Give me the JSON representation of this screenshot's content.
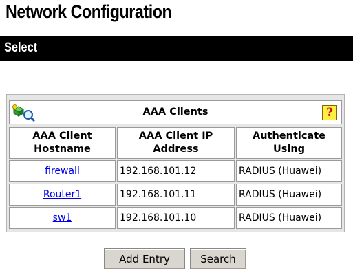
{
  "page": {
    "title": "Network Configuration"
  },
  "section": {
    "label": "Select"
  },
  "table": {
    "title": "AAA Clients",
    "icons": {
      "add": "add-clients-icon",
      "help": "help-icon"
    },
    "help_glyph": "?",
    "headers": [
      [
        "AAA Client",
        "Hostname"
      ],
      [
        "AAA Client IP",
        "Address"
      ],
      [
        "Authenticate",
        "Using"
      ]
    ],
    "rows": [
      {
        "hostname": "firewall",
        "ip": "192.168.101.12",
        "auth": "RADIUS (Huawei)"
      },
      {
        "hostname": "Router1",
        "ip": "192.168.101.11",
        "auth": "RADIUS (Huawei)"
      },
      {
        "hostname": "sw1",
        "ip": "192.168.101.10",
        "auth": "RADIUS (Huawei)"
      }
    ]
  },
  "buttons": {
    "add_entry": "Add Entry",
    "search": "Search"
  },
  "colors": {
    "section_bg": "#000000",
    "panel_bg": "#e6e6e6",
    "link": "#0000ee",
    "help_bg": "#ffee44"
  }
}
